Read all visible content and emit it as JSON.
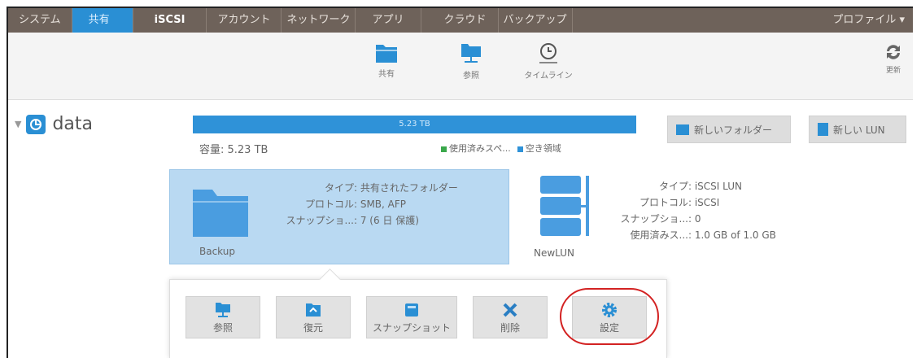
{
  "nav": {
    "tabs": [
      "システム",
      "共有",
      "iSCSI",
      "アカウント",
      "ネットワーク",
      "アプリ",
      "クラウド",
      "バックアップ"
    ],
    "active_tab": "共有",
    "profile": "プロファイル ▾"
  },
  "toolbar": {
    "shares_label": "共有",
    "browse_label": "参照",
    "timeline_label": "タイムライン",
    "refresh_label": "更新"
  },
  "volume": {
    "name": "data",
    "bar_label": "5.23 TB",
    "capacity": "容量: 5.23 TB",
    "legend_used": "使用済みスペ...",
    "legend_free": "空き領域",
    "used_color": "#3aa84b",
    "free_color": "#2f92d8",
    "new_folder": "新しいフォルダー",
    "new_lun": "新しい LUN"
  },
  "share": {
    "name": "Backup",
    "type_k": "タイプ:",
    "type_v": "共有されたフォルダー",
    "protocol_k": "プロトコル:",
    "protocol_v": "SMB, AFP",
    "snapshot_k": "スナップショ...:",
    "snapshot_v": "7 (6 日 保護)"
  },
  "lun": {
    "name": "NewLUN",
    "type_k": "タイプ:",
    "type_v": "iSCSI LUN",
    "protocol_k": "プロトコル:",
    "protocol_v": "iSCSI",
    "snapshot_k": "スナップショ...:",
    "snapshot_v": "0",
    "used_k": "使用済みス...:",
    "used_v": "1.0 GB of 1.0 GB"
  },
  "actions": {
    "browse": "参照",
    "restore": "復元",
    "snapshot": "スナップショット",
    "delete": "削除",
    "settings": "設定"
  }
}
